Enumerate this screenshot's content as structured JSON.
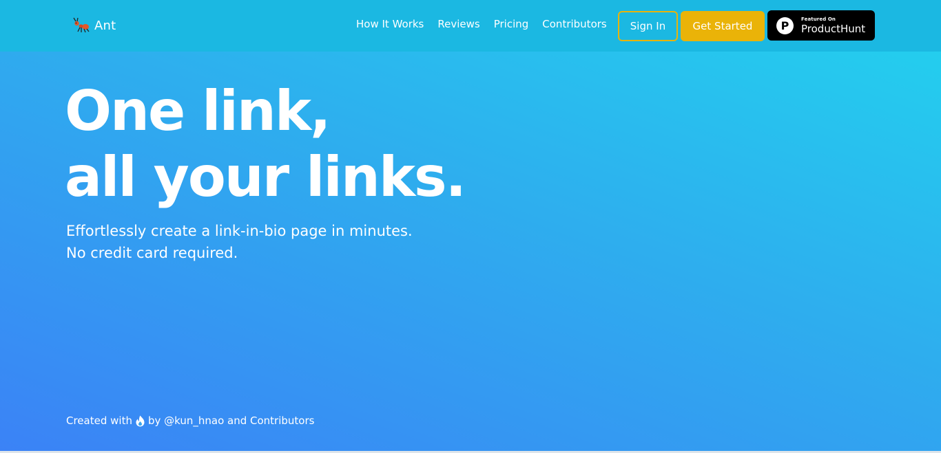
{
  "brand": {
    "name": "Ant",
    "logo_icon": "ant-icon"
  },
  "nav": {
    "links": [
      {
        "label": "How It Works"
      },
      {
        "label": "Reviews"
      },
      {
        "label": "Pricing"
      },
      {
        "label": "Contributors"
      }
    ],
    "sign_in_label": "Sign In",
    "get_started_label": "Get Started",
    "product_hunt": {
      "small_label": "Featured On",
      "big_label": "ProductHunt",
      "icon_letter": "P"
    }
  },
  "hero": {
    "title_line1": "One link,",
    "title_line2": "all your links.",
    "subtitle_line1": "Effortlessly create a link-in-bio page in minutes.",
    "subtitle_line2": "No credit card required."
  },
  "footer": {
    "prefix": "Created with",
    "icon": "fire-icon",
    "suffix": "by @kun_hnao and Contributors"
  },
  "colors": {
    "navbar": "#1bb8e2",
    "accent_yellow": "#eab308",
    "gradient_top": "#22d3ee",
    "gradient_bottom": "#3b82f6"
  }
}
